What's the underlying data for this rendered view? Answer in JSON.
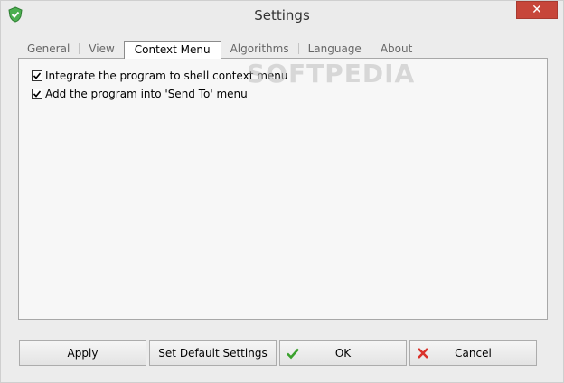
{
  "window": {
    "title": "Settings"
  },
  "tabs": [
    {
      "label": "General",
      "active": false
    },
    {
      "label": "View",
      "active": false
    },
    {
      "label": "Context Menu",
      "active": true
    },
    {
      "label": "Algorithms",
      "active": false
    },
    {
      "label": "Language",
      "active": false
    },
    {
      "label": "About",
      "active": false
    }
  ],
  "options": [
    {
      "label": "Integrate the program to shell context menu",
      "checked": true
    },
    {
      "label": "Add the program into 'Send To' menu",
      "checked": true
    }
  ],
  "watermark": "SOFTPEDIA",
  "buttons": {
    "apply": "Apply",
    "set_default": "Set Default Settings",
    "ok": "OK",
    "cancel": "Cancel"
  },
  "colors": {
    "ok_icon": "#3aa12d",
    "cancel_icon": "#d9322b",
    "close_button": "#c7463a"
  }
}
